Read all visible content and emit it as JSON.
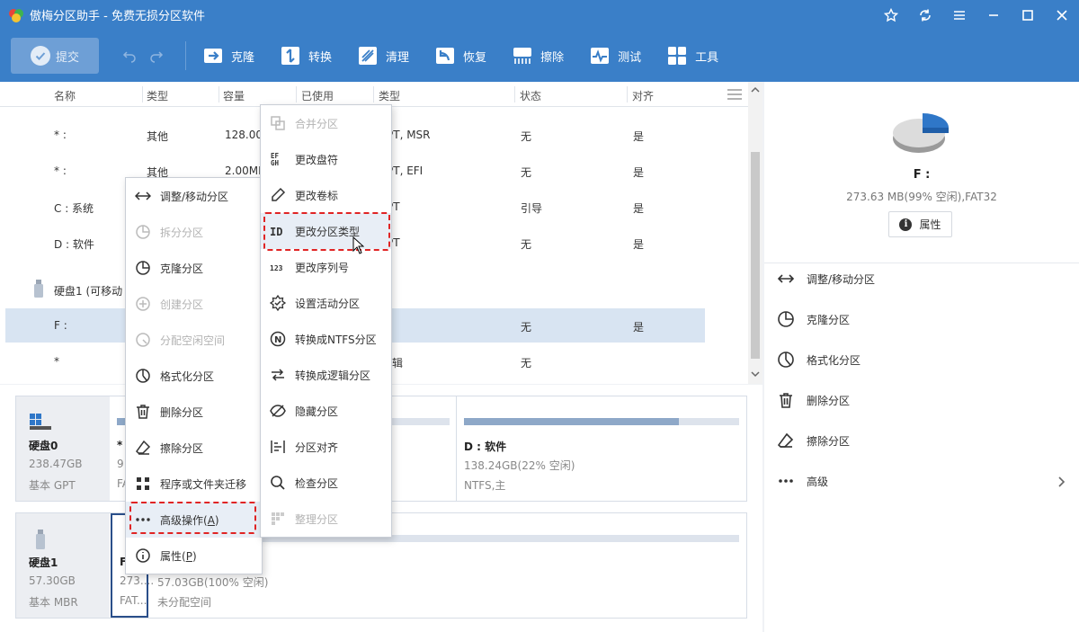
{
  "app": {
    "title": "傲梅分区助手 - 免费无损分区软件"
  },
  "colors": {
    "brand": "#3a7fc8",
    "selected_row": "#d8e4f2",
    "highlight_box": "#e02424"
  },
  "titlebar_icons": [
    "star-icon",
    "refresh-icon",
    "menu-icon",
    "minimize-icon",
    "maximize-icon",
    "close-icon"
  ],
  "toolbar": {
    "submit": "提交",
    "items": [
      {
        "label": "克隆",
        "icon": "clone-icon"
      },
      {
        "label": "转换",
        "icon": "convert-icon"
      },
      {
        "label": "清理",
        "icon": "clean-icon"
      },
      {
        "label": "恢复",
        "icon": "recover-icon"
      },
      {
        "label": "擦除",
        "icon": "wipe-icon"
      },
      {
        "label": "测试",
        "icon": "test-icon"
      },
      {
        "label": "工具",
        "icon": "tools-icon"
      }
    ]
  },
  "table": {
    "columns": [
      "名称",
      "类型",
      "容量",
      "已使用",
      "类型",
      "状态",
      "对齐"
    ],
    "rows": [
      {
        "name": "* :",
        "type": "其他",
        "capacity": "128.00",
        "fs": "PT, MSR",
        "status": "无",
        "align": "是"
      },
      {
        "name": "* :",
        "type": "其他",
        "capacity": "2.00MI",
        "fs": "PT, EFI",
        "status": "无",
        "align": "是"
      },
      {
        "name": "C : 系统",
        "fs": "PT",
        "status": "引导",
        "align": "是"
      },
      {
        "name": "D : 软件",
        "fs": "PT",
        "status": "无",
        "align": "是"
      },
      {
        "name": "硬盘1 (可移动"
      },
      {
        "name": "F :",
        "status": "无",
        "align": "是"
      },
      {
        "name": "*",
        "fs": "辑",
        "status": "无"
      }
    ]
  },
  "disks": [
    {
      "name": "硬盘0",
      "size": "238.47GB",
      "scheme": "基本 GPT",
      "partitions": [
        {
          "name": "*",
          "line1": "9",
          "line2": "FA",
          "fill": 0.1
        },
        {
          "name": "D : 软件",
          "line1": "138.24GB(22% 空闲)",
          "line2": "NTFS,主",
          "fill": 0.78
        }
      ]
    },
    {
      "name": "硬盘1",
      "size": "57.30GB",
      "scheme": "基本 MBR",
      "partitions": [
        {
          "name": "F",
          "line1": "273....",
          "line2": "FAT...",
          "fill": 0.01
        },
        {
          "line1": "57.03GB(100% 空闲)",
          "line2": "未分配空间",
          "fill": 0.0
        }
      ]
    }
  ],
  "right_panel": {
    "selected_name": "F :",
    "selected_detail": "273.63 MB(99% 空闲),FAT32",
    "properties_btn": "属性",
    "operations": [
      "调整/移动分区",
      "克隆分区",
      "格式化分区",
      "删除分区",
      "擦除分区",
      "高级"
    ]
  },
  "context_menu": {
    "items": [
      {
        "label": "调整/移动分区",
        "disabled": false
      },
      {
        "label": "拆分分区",
        "disabled": true
      },
      {
        "label": "克隆分区",
        "disabled": false
      },
      {
        "label": "创建分区",
        "disabled": true
      },
      {
        "label": "分配空闲空间",
        "disabled": true
      },
      {
        "label": "格式化分区",
        "disabled": false
      },
      {
        "label": "删除分区",
        "disabled": false
      },
      {
        "label": "擦除分区",
        "disabled": false
      },
      {
        "label": "程序或文件夹迁移",
        "disabled": false
      },
      {
        "label": "高级操作(",
        "key": "A",
        "suffix": ")",
        "disabled": false,
        "highlighted": true
      },
      {
        "label": "属性(",
        "key": "P",
        "suffix": ")",
        "disabled": false
      }
    ]
  },
  "submenu": {
    "items": [
      {
        "label": "合并分区",
        "disabled": true
      },
      {
        "label": "更改盘符",
        "disabled": false
      },
      {
        "label": "更改卷标",
        "disabled": false
      },
      {
        "label": "更改分区类型",
        "disabled": false,
        "highlighted": true
      },
      {
        "label": "更改序列号",
        "disabled": false
      },
      {
        "label": "设置活动分区",
        "disabled": false
      },
      {
        "label": "转换成NTFS分区",
        "disabled": false
      },
      {
        "label": "转换成逻辑分区",
        "disabled": false
      },
      {
        "label": "隐藏分区",
        "disabled": false
      },
      {
        "label": "分区对齐",
        "disabled": false
      },
      {
        "label": "检查分区",
        "disabled": false
      },
      {
        "label": "整理分区",
        "disabled": true
      }
    ]
  }
}
